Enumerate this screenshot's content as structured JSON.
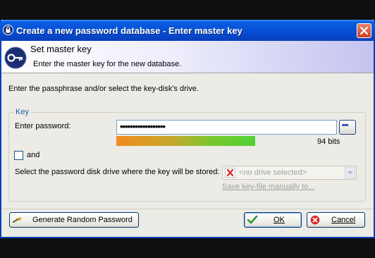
{
  "window": {
    "title": "Create a new password database - Enter master key"
  },
  "header": {
    "title": "Set master key",
    "subtitle": "Enter the master key for the new database."
  },
  "instructions": "Enter the passphrase and/or select the key-disk's drive.",
  "key_group": {
    "legend": "Key",
    "password_label": "Enter password:",
    "password_mask": "••••••••••••••••••",
    "reveal_button": "•••",
    "quality_fraction": 0.63,
    "quality_text": "94 bits",
    "and_label": "and",
    "drive_label": "Select the password disk drive where the key will be stored:",
    "drive_value": "<no drive selected>",
    "save_keyfile_link": "Save key-file manually to..."
  },
  "buttons": {
    "generate": "Generate Random Password",
    "ok": "OK",
    "cancel": "Cancel"
  },
  "icons": {
    "app": "lock-icon",
    "header": "key-badge-icon",
    "generate": "wand-icon",
    "ok": "check-icon",
    "cancel": "cancel-icon",
    "drive": "x-icon"
  }
}
